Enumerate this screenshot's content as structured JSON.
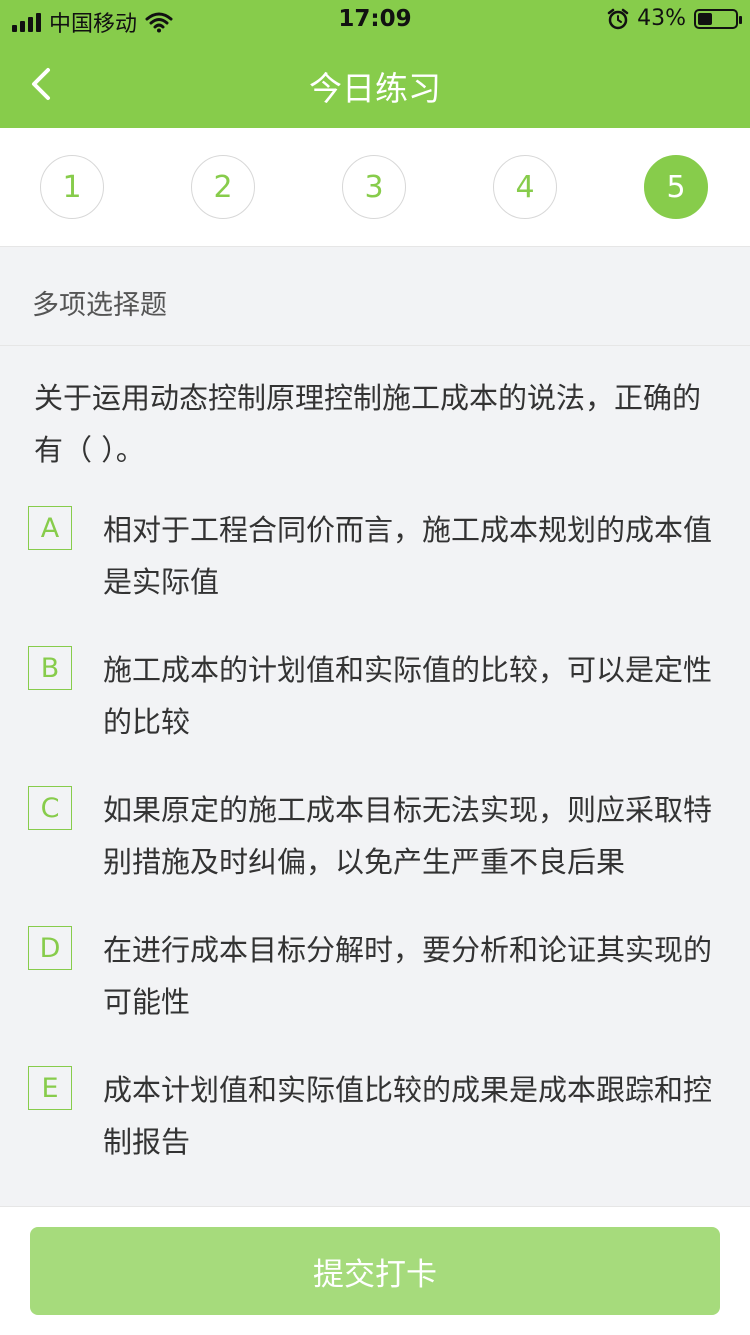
{
  "status_bar": {
    "carrier": "中国移动",
    "time": "17:09",
    "battery": "43%"
  },
  "nav": {
    "title": "今日练习"
  },
  "steps": [
    "1",
    "2",
    "3",
    "4",
    "5"
  ],
  "active_step": "5",
  "question": {
    "type": "多项选择题",
    "text": "关于运用动态控制原理控制施工成本的说法，正确的有（   ）。",
    "options": [
      {
        "letter": "A",
        "text": "相对于工程合同价而言，施工成本规划的成本值是实际值"
      },
      {
        "letter": "B",
        "text": "施工成本的计划值和实际值的比较，可以是定性的比较"
      },
      {
        "letter": "C",
        "text": "如果原定的施工成本目标无法实现，则应采取特别措施及时纠偏，以免产生严重不良后果"
      },
      {
        "letter": "D",
        "text": "在进行成本目标分解时，要分析和论证其实现的可能性"
      },
      {
        "letter": "E",
        "text": "成本计划值和实际值比较的成果是成本跟踪和控制报告"
      }
    ]
  },
  "submit_label": "提交打卡",
  "colors": {
    "brand_green": "#87cc4b",
    "submit_disabled": "#a6db7c"
  }
}
